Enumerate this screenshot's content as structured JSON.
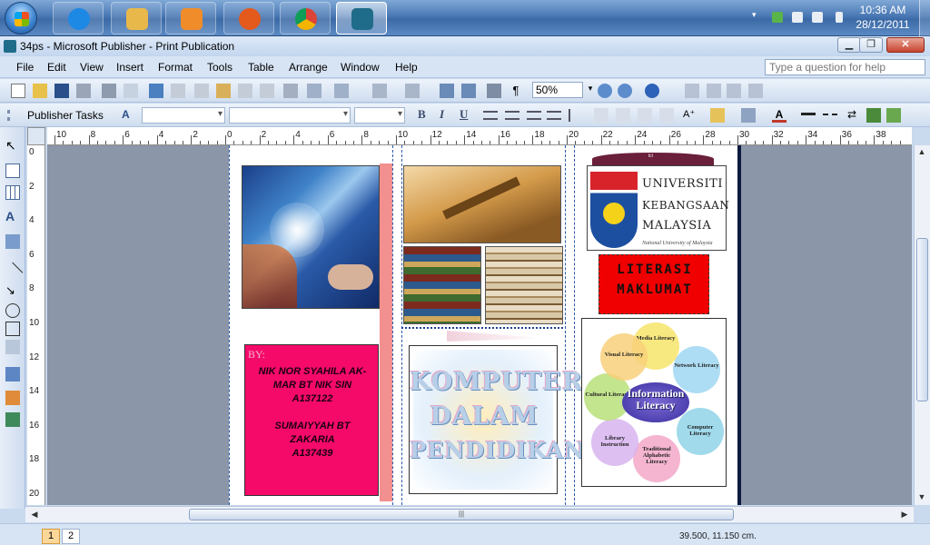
{
  "taskbar": {
    "pinned": [
      {
        "name": "internet-explorer-icon",
        "color": "#1e88e5"
      },
      {
        "name": "windows-explorer-icon",
        "color": "#e8b84a"
      },
      {
        "name": "media-player-icon",
        "color": "#f08c2a"
      },
      {
        "name": "firefox-icon",
        "color": "#e4591c"
      },
      {
        "name": "chrome-icon",
        "color": "#3aa757"
      },
      {
        "name": "publisher-icon",
        "color": "#1f6c8a"
      }
    ],
    "clock_time": "10:36 AM",
    "clock_date": "28/12/2011"
  },
  "window": {
    "title": "34ps - Microsoft Publisher - Print Publication",
    "minimize_label": "▁",
    "maximize_label": "❐",
    "close_label": "✕"
  },
  "menu": {
    "items": [
      "File",
      "Edit",
      "View",
      "Insert",
      "Format",
      "Tools",
      "Table",
      "Arrange",
      "Window",
      "Help"
    ],
    "help_placeholder": "Type a question for help"
  },
  "toolbar": {
    "zoom_value": "50%",
    "publisher_tasks_label": "Publisher Tasks"
  },
  "ruler": {
    "h_labels": [
      "10",
      "8",
      "6",
      "4",
      "2",
      "0",
      "2",
      "4",
      "6",
      "8",
      "10",
      "12",
      "14",
      "16",
      "18",
      "20",
      "22",
      "24",
      "26",
      "28",
      "30",
      "32",
      "34",
      "36",
      "38"
    ],
    "v_labels": [
      "0",
      "2",
      "4",
      "6",
      "8",
      "10",
      "12",
      "14",
      "16",
      "18",
      "20"
    ]
  },
  "document": {
    "by_label": "BY:",
    "author_lines": [
      "NIK NOR SYAHILA AK-",
      "MAR BT NIK SIN",
      "A137122",
      "",
      "SUMAIYYAH BT",
      "ZAKARIA",
      "A137439"
    ],
    "komputer_lines": [
      "KOMPUTER",
      "DALAM",
      "PENDIDIKAN"
    ],
    "ukm_tab_text": "lcl",
    "ukm_lines": [
      "UNIVERSITI",
      "KEBANGSAAN",
      "MALAYSIA"
    ],
    "ukm_sub": "National University of Malaysia",
    "literasi_lines": [
      "LITERASI",
      "MAKLUMAT"
    ],
    "info_center": "Information Literacy",
    "petals": [
      {
        "label": "Media Literacy",
        "color": "#f7e46a"
      },
      {
        "label": "Network Literacy",
        "color": "#9fd7f2"
      },
      {
        "label": "Computer Literacy",
        "color": "#8fd3e8"
      },
      {
        "label": "Traditional Alphabetic Literacy",
        "color": "#f3a8c8"
      },
      {
        "label": "Library Instruction",
        "color": "#d8b4f0"
      },
      {
        "label": "Cultural Literacy",
        "color": "#b8e07a"
      },
      {
        "label": "Visual Literacy",
        "color": "#f9d07a"
      }
    ]
  },
  "status": {
    "pages": [
      "1",
      "2"
    ],
    "current_page": "1",
    "coordinates": "39.500, 11.150 cm."
  }
}
